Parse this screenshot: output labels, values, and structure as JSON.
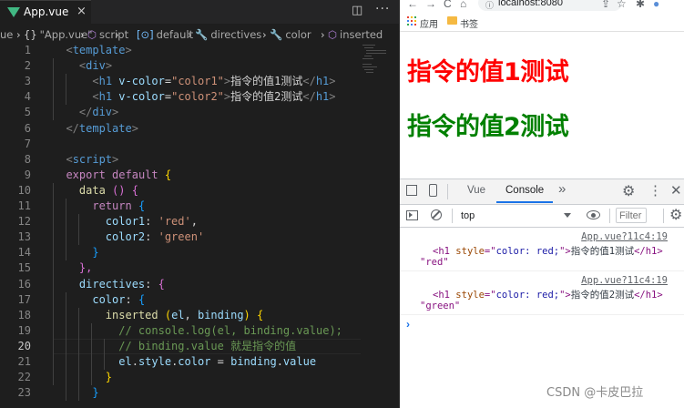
{
  "editor": {
    "tab": {
      "title": "App.vue",
      "close": "×"
    },
    "actions": {
      "split": "◫",
      "more": "···"
    },
    "breadcrumb": [
      {
        "icon": "",
        "label": "ue"
      },
      {
        "icon": "›",
        "label": ""
      },
      {
        "icon": "{}",
        "label": "\"App.vue\""
      },
      {
        "icon": "›",
        "label": ""
      },
      {
        "icon": "⬡",
        "label": "script"
      },
      {
        "icon": "›",
        "label": ""
      },
      {
        "icon": "[⊙]",
        "label": "default"
      },
      {
        "icon": "›",
        "label": ""
      },
      {
        "icon": "🔧",
        "label": "directives"
      },
      {
        "icon": "›",
        "label": ""
      },
      {
        "icon": "🔧",
        "label": "color"
      },
      {
        "icon": "›",
        "label": ""
      },
      {
        "icon": "⬡",
        "label": "inserted"
      }
    ],
    "line_numbers": [
      "1",
      "2",
      "3",
      "4",
      "5",
      "6",
      "7",
      "8",
      "9",
      "10",
      "11",
      "12",
      "13",
      "14",
      "15",
      "16",
      "17",
      "18",
      "19",
      "20",
      "21",
      "22",
      "23"
    ],
    "active_line": "20",
    "lines": [
      [
        [
          "  ",
          "text"
        ],
        [
          "<",
          "punc"
        ],
        [
          "template",
          "tag"
        ],
        [
          ">",
          "punc"
        ]
      ],
      [
        [
          "    ",
          "text"
        ],
        [
          "<",
          "punc"
        ],
        [
          "div",
          "tag"
        ],
        [
          ">",
          "punc"
        ]
      ],
      [
        [
          "      ",
          "text"
        ],
        [
          "<",
          "punc"
        ],
        [
          "h1",
          "tag"
        ],
        [
          " ",
          "text"
        ],
        [
          "v-color",
          "attr"
        ],
        [
          "=",
          "text"
        ],
        [
          "\"color1\"",
          "str"
        ],
        [
          ">",
          "punc"
        ],
        [
          "指令的值1测试",
          "text"
        ],
        [
          "</",
          "punc"
        ],
        [
          "h1",
          "tag"
        ],
        [
          ">",
          "punc"
        ]
      ],
      [
        [
          "      ",
          "text"
        ],
        [
          "<",
          "punc"
        ],
        [
          "h1",
          "tag"
        ],
        [
          " ",
          "text"
        ],
        [
          "v-color",
          "attr"
        ],
        [
          "=",
          "text"
        ],
        [
          "\"color2\"",
          "str"
        ],
        [
          ">",
          "punc"
        ],
        [
          "指令的值2测试",
          "text"
        ],
        [
          "</",
          "punc"
        ],
        [
          "h1",
          "tag"
        ],
        [
          ">",
          "punc"
        ]
      ],
      [
        [
          "    ",
          "text"
        ],
        [
          "</",
          "punc"
        ],
        [
          "div",
          "tag"
        ],
        [
          ">",
          "punc"
        ]
      ],
      [
        [
          "  ",
          "text"
        ],
        [
          "</",
          "punc"
        ],
        [
          "template",
          "tag"
        ],
        [
          ">",
          "punc"
        ]
      ],
      [
        [
          "",
          "text"
        ]
      ],
      [
        [
          "  ",
          "text"
        ],
        [
          "<",
          "punc"
        ],
        [
          "script",
          "tag"
        ],
        [
          ">",
          "punc"
        ]
      ],
      [
        [
          "  ",
          "text"
        ],
        [
          "export",
          "kw"
        ],
        [
          " ",
          "text"
        ],
        [
          "default",
          "kw"
        ],
        [
          " ",
          "text"
        ],
        [
          "{",
          "br1"
        ]
      ],
      [
        [
          "    ",
          "text"
        ],
        [
          "data",
          "fn"
        ],
        [
          " ",
          "text"
        ],
        [
          "()",
          "br2"
        ],
        [
          " ",
          "text"
        ],
        [
          "{",
          "br2"
        ]
      ],
      [
        [
          "      ",
          "text"
        ],
        [
          "return",
          "kw"
        ],
        [
          " ",
          "text"
        ],
        [
          "{",
          "br3"
        ]
      ],
      [
        [
          "        ",
          "text"
        ],
        [
          "color1",
          "var"
        ],
        [
          ": ",
          "text"
        ],
        [
          "'red'",
          "str"
        ],
        [
          ",",
          "text"
        ]
      ],
      [
        [
          "        ",
          "text"
        ],
        [
          "color2",
          "var"
        ],
        [
          ": ",
          "text"
        ],
        [
          "'green'",
          "str"
        ]
      ],
      [
        [
          "      ",
          "text"
        ],
        [
          "}",
          "br3"
        ]
      ],
      [
        [
          "    ",
          "text"
        ],
        [
          "},",
          "br2"
        ]
      ],
      [
        [
          "    ",
          "text"
        ],
        [
          "directives",
          "var"
        ],
        [
          ": ",
          "text"
        ],
        [
          "{",
          "br2"
        ]
      ],
      [
        [
          "      ",
          "text"
        ],
        [
          "color",
          "var"
        ],
        [
          ": ",
          "text"
        ],
        [
          "{",
          "br3"
        ]
      ],
      [
        [
          "        ",
          "text"
        ],
        [
          "inserted",
          "fn"
        ],
        [
          " ",
          "text"
        ],
        [
          "(",
          "br1"
        ],
        [
          "el",
          "var"
        ],
        [
          ", ",
          "text"
        ],
        [
          "binding",
          "var"
        ],
        [
          ")",
          "br1"
        ],
        [
          " ",
          "text"
        ],
        [
          "{",
          "br1"
        ]
      ],
      [
        [
          "          ",
          "text"
        ],
        [
          "// console.log(el, binding.value);",
          "com"
        ]
      ],
      [
        [
          "          ",
          "text"
        ],
        [
          "// binding.value 就是指令的值",
          "com"
        ]
      ],
      [
        [
          "          ",
          "text"
        ],
        [
          "el",
          "var"
        ],
        [
          ".",
          "text"
        ],
        [
          "style",
          "var"
        ],
        [
          ".",
          "text"
        ],
        [
          "color",
          "var"
        ],
        [
          " = ",
          "text"
        ],
        [
          "binding",
          "var"
        ],
        [
          ".",
          "text"
        ],
        [
          "value",
          "var"
        ]
      ],
      [
        [
          "        ",
          "text"
        ],
        [
          "}",
          "br1"
        ]
      ],
      [
        [
          "      ",
          "text"
        ],
        [
          "}",
          "br3"
        ]
      ]
    ]
  },
  "browser": {
    "nav": {
      "back": "←",
      "forward": "→",
      "reload": "C",
      "home": "⌂",
      "lock": "ⓘ",
      "url": "localhost:8080",
      "share": "⇪",
      "star": "☆",
      "ext": "✱",
      "profile": "●"
    },
    "bookmarks": {
      "apps": "应用",
      "folder": "书签"
    },
    "page": {
      "headings": [
        {
          "text": "指令的值1测试",
          "color": "#ff0000"
        },
        {
          "text": "指令的值2测试",
          "color": "#008000"
        }
      ]
    },
    "devtools": {
      "tabs": {
        "vue": "Vue",
        "console": "Console",
        "more": "»"
      },
      "icons": {
        "gear": "⚙",
        "kebab": "⋮",
        "close": "✕"
      },
      "context": "top",
      "filter_placeholder": "Filter",
      "messages": [
        {
          "source": "App.vue?11c4:19",
          "element": {
            "open": "<h1 ",
            "attr_name": "style",
            "attr_eq": "=\"",
            "attr_value": "color: red;",
            "attr_close": "\">",
            "text": "指令的值1测试",
            "close": "</h1>"
          },
          "value": "\"red\""
        },
        {
          "source": "App.vue?11c4:19",
          "element": {
            "open": "<h1 ",
            "attr_name": "style",
            "attr_eq": "=\"",
            "attr_value": "color: red;",
            "attr_close": "\">",
            "text": "指令的值2测试",
            "close": "</h1>"
          },
          "value": "\"green\""
        }
      ],
      "prompt": "›"
    }
  },
  "watermark": "CSDN @卡皮巴拉"
}
